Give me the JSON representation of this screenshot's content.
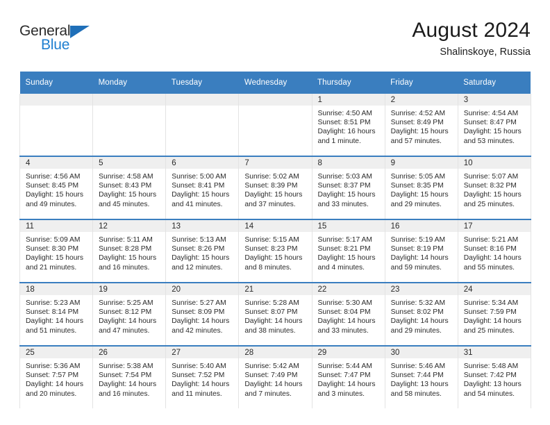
{
  "brand": {
    "name_top": "General",
    "name_bottom": "Blue",
    "triangle_color": "#1f6fb8",
    "blue_color": "#1f7fd0"
  },
  "header": {
    "title": "August 2024",
    "subtitle": "Shalinskoye, Russia"
  },
  "theme": {
    "header_bg": "#3a7ebf",
    "row_divider": "#3a7ebf",
    "daynum_bg": "#efefef",
    "cell_border": "#e3e3e3",
    "text": "#2a2a2a"
  },
  "weekday_headers": [
    "Sunday",
    "Monday",
    "Tuesday",
    "Wednesday",
    "Thursday",
    "Friday",
    "Saturday"
  ],
  "labels": {
    "sunrise": "Sunrise:",
    "sunset": "Sunset:",
    "daylight": "Daylight:"
  },
  "weeks": [
    [
      {
        "day": "",
        "empty": true
      },
      {
        "day": "",
        "empty": true
      },
      {
        "day": "",
        "empty": true
      },
      {
        "day": "",
        "empty": true
      },
      {
        "day": "1",
        "sunrise": "Sunrise: 4:50 AM",
        "sunset": "Sunset: 8:51 PM",
        "daylight_line1": "Daylight: 16 hours",
        "daylight_line2": "and 1 minute."
      },
      {
        "day": "2",
        "sunrise": "Sunrise: 4:52 AM",
        "sunset": "Sunset: 8:49 PM",
        "daylight_line1": "Daylight: 15 hours",
        "daylight_line2": "and 57 minutes."
      },
      {
        "day": "3",
        "sunrise": "Sunrise: 4:54 AM",
        "sunset": "Sunset: 8:47 PM",
        "daylight_line1": "Daylight: 15 hours",
        "daylight_line2": "and 53 minutes."
      }
    ],
    [
      {
        "day": "4",
        "sunrise": "Sunrise: 4:56 AM",
        "sunset": "Sunset: 8:45 PM",
        "daylight_line1": "Daylight: 15 hours",
        "daylight_line2": "and 49 minutes."
      },
      {
        "day": "5",
        "sunrise": "Sunrise: 4:58 AM",
        "sunset": "Sunset: 8:43 PM",
        "daylight_line1": "Daylight: 15 hours",
        "daylight_line2": "and 45 minutes."
      },
      {
        "day": "6",
        "sunrise": "Sunrise: 5:00 AM",
        "sunset": "Sunset: 8:41 PM",
        "daylight_line1": "Daylight: 15 hours",
        "daylight_line2": "and 41 minutes."
      },
      {
        "day": "7",
        "sunrise": "Sunrise: 5:02 AM",
        "sunset": "Sunset: 8:39 PM",
        "daylight_line1": "Daylight: 15 hours",
        "daylight_line2": "and 37 minutes."
      },
      {
        "day": "8",
        "sunrise": "Sunrise: 5:03 AM",
        "sunset": "Sunset: 8:37 PM",
        "daylight_line1": "Daylight: 15 hours",
        "daylight_line2": "and 33 minutes."
      },
      {
        "day": "9",
        "sunrise": "Sunrise: 5:05 AM",
        "sunset": "Sunset: 8:35 PM",
        "daylight_line1": "Daylight: 15 hours",
        "daylight_line2": "and 29 minutes."
      },
      {
        "day": "10",
        "sunrise": "Sunrise: 5:07 AM",
        "sunset": "Sunset: 8:32 PM",
        "daylight_line1": "Daylight: 15 hours",
        "daylight_line2": "and 25 minutes."
      }
    ],
    [
      {
        "day": "11",
        "sunrise": "Sunrise: 5:09 AM",
        "sunset": "Sunset: 8:30 PM",
        "daylight_line1": "Daylight: 15 hours",
        "daylight_line2": "and 21 minutes."
      },
      {
        "day": "12",
        "sunrise": "Sunrise: 5:11 AM",
        "sunset": "Sunset: 8:28 PM",
        "daylight_line1": "Daylight: 15 hours",
        "daylight_line2": "and 16 minutes."
      },
      {
        "day": "13",
        "sunrise": "Sunrise: 5:13 AM",
        "sunset": "Sunset: 8:26 PM",
        "daylight_line1": "Daylight: 15 hours",
        "daylight_line2": "and 12 minutes."
      },
      {
        "day": "14",
        "sunrise": "Sunrise: 5:15 AM",
        "sunset": "Sunset: 8:23 PM",
        "daylight_line1": "Daylight: 15 hours",
        "daylight_line2": "and 8 minutes."
      },
      {
        "day": "15",
        "sunrise": "Sunrise: 5:17 AM",
        "sunset": "Sunset: 8:21 PM",
        "daylight_line1": "Daylight: 15 hours",
        "daylight_line2": "and 4 minutes."
      },
      {
        "day": "16",
        "sunrise": "Sunrise: 5:19 AM",
        "sunset": "Sunset: 8:19 PM",
        "daylight_line1": "Daylight: 14 hours",
        "daylight_line2": "and 59 minutes."
      },
      {
        "day": "17",
        "sunrise": "Sunrise: 5:21 AM",
        "sunset": "Sunset: 8:16 PM",
        "daylight_line1": "Daylight: 14 hours",
        "daylight_line2": "and 55 minutes."
      }
    ],
    [
      {
        "day": "18",
        "sunrise": "Sunrise: 5:23 AM",
        "sunset": "Sunset: 8:14 PM",
        "daylight_line1": "Daylight: 14 hours",
        "daylight_line2": "and 51 minutes."
      },
      {
        "day": "19",
        "sunrise": "Sunrise: 5:25 AM",
        "sunset": "Sunset: 8:12 PM",
        "daylight_line1": "Daylight: 14 hours",
        "daylight_line2": "and 47 minutes."
      },
      {
        "day": "20",
        "sunrise": "Sunrise: 5:27 AM",
        "sunset": "Sunset: 8:09 PM",
        "daylight_line1": "Daylight: 14 hours",
        "daylight_line2": "and 42 minutes."
      },
      {
        "day": "21",
        "sunrise": "Sunrise: 5:28 AM",
        "sunset": "Sunset: 8:07 PM",
        "daylight_line1": "Daylight: 14 hours",
        "daylight_line2": "and 38 minutes."
      },
      {
        "day": "22",
        "sunrise": "Sunrise: 5:30 AM",
        "sunset": "Sunset: 8:04 PM",
        "daylight_line1": "Daylight: 14 hours",
        "daylight_line2": "and 33 minutes."
      },
      {
        "day": "23",
        "sunrise": "Sunrise: 5:32 AM",
        "sunset": "Sunset: 8:02 PM",
        "daylight_line1": "Daylight: 14 hours",
        "daylight_line2": "and 29 minutes."
      },
      {
        "day": "24",
        "sunrise": "Sunrise: 5:34 AM",
        "sunset": "Sunset: 7:59 PM",
        "daylight_line1": "Daylight: 14 hours",
        "daylight_line2": "and 25 minutes."
      }
    ],
    [
      {
        "day": "25",
        "sunrise": "Sunrise: 5:36 AM",
        "sunset": "Sunset: 7:57 PM",
        "daylight_line1": "Daylight: 14 hours",
        "daylight_line2": "and 20 minutes."
      },
      {
        "day": "26",
        "sunrise": "Sunrise: 5:38 AM",
        "sunset": "Sunset: 7:54 PM",
        "daylight_line1": "Daylight: 14 hours",
        "daylight_line2": "and 16 minutes."
      },
      {
        "day": "27",
        "sunrise": "Sunrise: 5:40 AM",
        "sunset": "Sunset: 7:52 PM",
        "daylight_line1": "Daylight: 14 hours",
        "daylight_line2": "and 11 minutes."
      },
      {
        "day": "28",
        "sunrise": "Sunrise: 5:42 AM",
        "sunset": "Sunset: 7:49 PM",
        "daylight_line1": "Daylight: 14 hours",
        "daylight_line2": "and 7 minutes."
      },
      {
        "day": "29",
        "sunrise": "Sunrise: 5:44 AM",
        "sunset": "Sunset: 7:47 PM",
        "daylight_line1": "Daylight: 14 hours",
        "daylight_line2": "and 3 minutes."
      },
      {
        "day": "30",
        "sunrise": "Sunrise: 5:46 AM",
        "sunset": "Sunset: 7:44 PM",
        "daylight_line1": "Daylight: 13 hours",
        "daylight_line2": "and 58 minutes."
      },
      {
        "day": "31",
        "sunrise": "Sunrise: 5:48 AM",
        "sunset": "Sunset: 7:42 PM",
        "daylight_line1": "Daylight: 13 hours",
        "daylight_line2": "and 54 minutes."
      }
    ]
  ]
}
